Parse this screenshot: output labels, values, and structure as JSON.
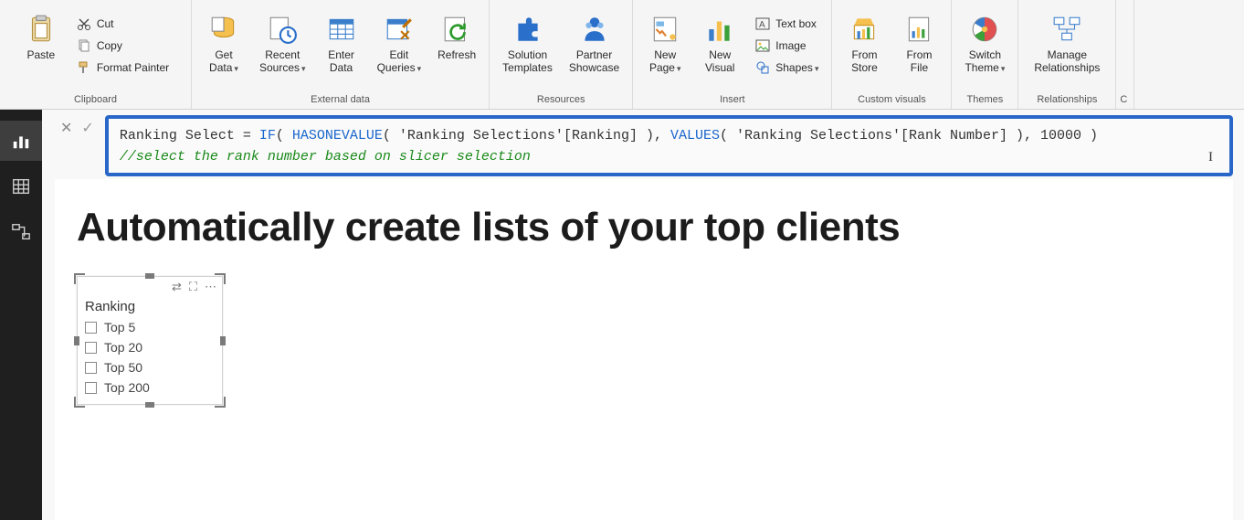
{
  "ribbon": {
    "clipboard": {
      "group_label": "Clipboard",
      "paste": "Paste",
      "cut": "Cut",
      "copy": "Copy",
      "format_painter": "Format Painter"
    },
    "external_data": {
      "group_label": "External data",
      "get_data": "Get\nData",
      "recent_sources": "Recent\nSources",
      "enter_data": "Enter\nData",
      "edit_queries": "Edit\nQueries",
      "refresh": "Refresh"
    },
    "resources": {
      "group_label": "Resources",
      "solution_templates": "Solution\nTemplates",
      "partner_showcase": "Partner\nShowcase"
    },
    "insert": {
      "group_label": "Insert",
      "new_page": "New\nPage",
      "new_visual": "New\nVisual",
      "text_box": "Text box",
      "image": "Image",
      "shapes": "Shapes"
    },
    "custom_visuals": {
      "group_label": "Custom visuals",
      "from_store": "From\nStore",
      "from_file": "From\nFile"
    },
    "themes": {
      "group_label": "Themes",
      "switch_theme": "Switch\nTheme"
    },
    "relationships": {
      "group_label": "Relationships",
      "manage": "Manage\nRelationships"
    },
    "calculations": {
      "group_label": "C"
    }
  },
  "formula": {
    "pre": "Ranking Select = ",
    "fn1": "IF",
    "mid1": "( ",
    "fn2": "HASONEVALUE",
    "mid2": "( 'Ranking Selections'[Ranking] ), ",
    "fn3": "VALUES",
    "mid3": "( 'Ranking Selections'[Rank Number] ), 10000 )",
    "comment": "//select the rank number based on slicer selection"
  },
  "canvas": {
    "headline": "Automatically create lists of your top clients",
    "slicer": {
      "title": "Ranking",
      "items": [
        "Top 5",
        "Top 20",
        "Top 50",
        "Top 200"
      ]
    }
  }
}
